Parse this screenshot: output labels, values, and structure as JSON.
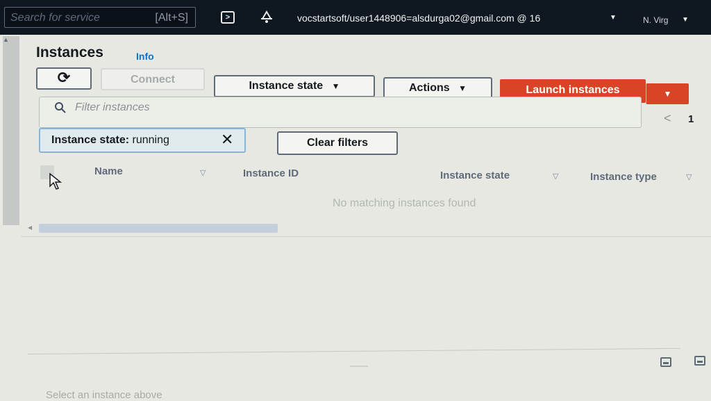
{
  "topbar": {
    "search_placeholder": "Search for service",
    "search_shortcut": "[Alt+S]",
    "account": "vocstartsoft/user1448906=alsdurga02@gmail.com @ 16",
    "region": "N. Virg",
    "icons": [
      "cloudshell-icon",
      "bell-icon",
      "caret-down-icon"
    ]
  },
  "page": {
    "title": "Instances",
    "info": "Info"
  },
  "toolbar": {
    "refresh_icon": "⟳",
    "connect": "Connect",
    "instance_state": "Instance state",
    "actions": "Actions",
    "launch": "Launch instances",
    "caret": "▼"
  },
  "filter": {
    "placeholder": "Filter instances",
    "page_prev": "<",
    "page_number": "1"
  },
  "token": {
    "key": "Instance state:",
    "value": " running",
    "close": "✕"
  },
  "clear_filters": "Clear filters",
  "table": {
    "columns": [
      "Name",
      "Instance ID",
      "Instance state",
      "Instance type"
    ],
    "sort_icon": "▽",
    "empty_message": "No matching instances found"
  },
  "details": {
    "placeholder": "Select an instance above"
  },
  "colors": {
    "accent_orange": "#d94427",
    "link_blue": "#0972d3",
    "topbar": "#0f1720"
  }
}
